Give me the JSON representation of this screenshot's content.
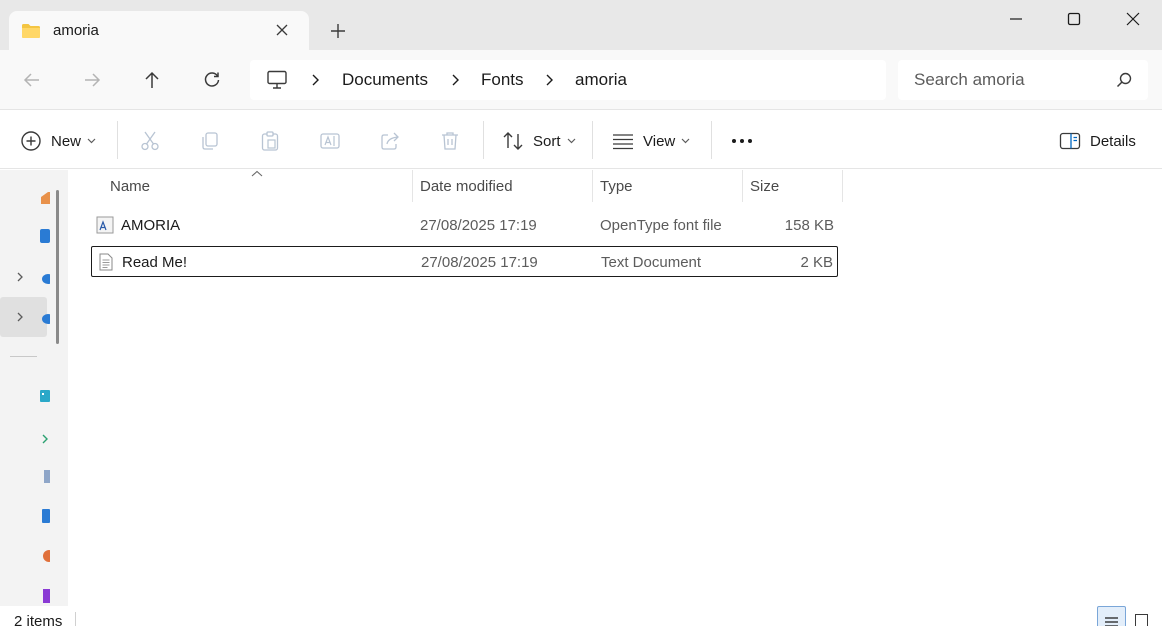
{
  "window": {
    "tab_title": "amoria"
  },
  "address": {
    "crumbs": [
      "Documents",
      "Fonts",
      "amoria"
    ]
  },
  "search": {
    "placeholder": "Search amoria"
  },
  "toolbar": {
    "new_label": "New",
    "sort_label": "Sort",
    "view_label": "View",
    "details_label": "Details"
  },
  "filelist": {
    "columns": {
      "name": "Name",
      "date": "Date modified",
      "type": "Type",
      "size": "Size"
    },
    "rows": [
      {
        "name": "AMORIA",
        "date": "27/08/2025 17:19",
        "type": "OpenType font file",
        "size": "158 KB",
        "icon": "font-file-icon"
      },
      {
        "name": "Read Me!",
        "date": "27/08/2025 17:19",
        "type": "Text Document",
        "size": "2 KB",
        "icon": "text-document-icon"
      }
    ]
  },
  "status": {
    "item_count": "2 items"
  },
  "colors": {
    "accent": "#0067c0",
    "folder": "#f4c542",
    "title_bar": "#e8e8e8",
    "nav_bar": "#f9f9f9"
  }
}
